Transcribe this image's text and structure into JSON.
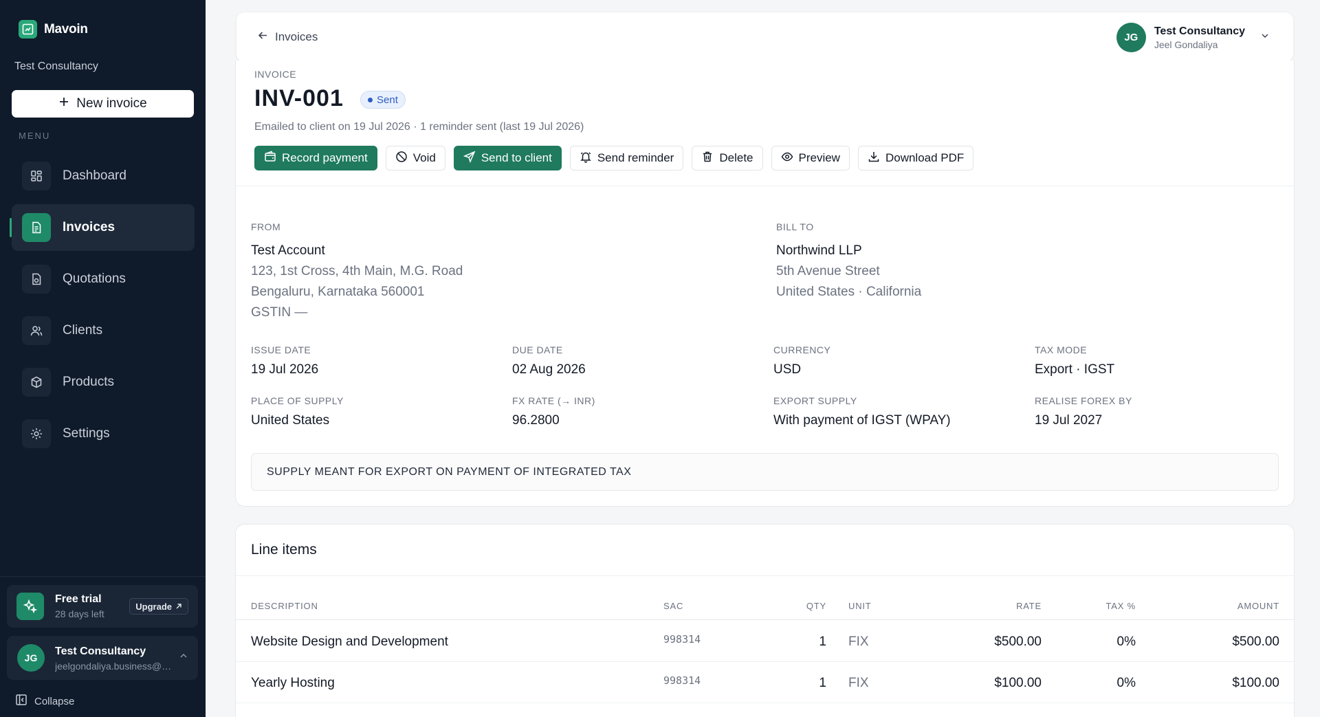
{
  "sidebar": {
    "brand": "Mavoin",
    "org": "Test Consultancy",
    "new_invoice": "New invoice",
    "menu_label": "MENU",
    "items": [
      {
        "label": "Dashboard",
        "icon": "dashboard-icon"
      },
      {
        "label": "Invoices",
        "icon": "invoice-icon",
        "active": true
      },
      {
        "label": "Quotations",
        "icon": "quotation-icon"
      },
      {
        "label": "Clients",
        "icon": "clients-icon"
      },
      {
        "label": "Products",
        "icon": "products-icon"
      },
      {
        "label": "Settings",
        "icon": "settings-icon"
      }
    ],
    "trial": {
      "title": "Free trial",
      "sub": "28 days left",
      "upgrade": "Upgrade"
    },
    "account": {
      "initials": "JG",
      "name": "Test Consultancy",
      "email": "jeelgondaliya.business@gmail.com"
    },
    "collapse": "Collapse"
  },
  "header": {
    "back": "Invoices",
    "user": {
      "initials": "JG",
      "name": "Test Consultancy",
      "sub": "Jeel Gondaliya"
    }
  },
  "invoice": {
    "label": "INVOICE",
    "number": "INV-001",
    "status": "Sent",
    "meta": "Emailed to client on 19 Jul 2026 · 1 reminder sent (last 19 Jul 2026)",
    "actions": {
      "record_payment": "Record payment",
      "void": "Void",
      "send_to_client": "Send to client",
      "send_reminder": "Send reminder",
      "delete": "Delete",
      "preview": "Preview",
      "download_pdf": "Download PDF"
    },
    "from": {
      "label": "FROM",
      "name": "Test Account",
      "line1": "123, 1st Cross, 4th Main, M.G. Road",
      "line2": "Bengaluru, Karnataka 560001",
      "line3": "GSTIN —"
    },
    "bill_to": {
      "label": "BILL TO",
      "name": "Northwind LLP",
      "line1": "5th Avenue Street",
      "line2": "United States · California"
    },
    "fields": {
      "issue_date": {
        "label": "ISSUE DATE",
        "value": "19 Jul 2026"
      },
      "due_date": {
        "label": "DUE DATE",
        "value": "02 Aug 2026"
      },
      "currency": {
        "label": "CURRENCY",
        "value": "USD"
      },
      "tax_mode": {
        "label": "TAX MODE",
        "value": "Export · IGST"
      },
      "place_of_supply": {
        "label": "PLACE OF SUPPLY",
        "value": "United States"
      },
      "fx_rate": {
        "label": "FX RATE (→ INR)",
        "value": "96.2800"
      },
      "export_supply": {
        "label": "EXPORT SUPPLY",
        "value": "With payment of IGST (WPAY)"
      },
      "realise_forex": {
        "label": "REALISE FOREX BY",
        "value": "19 Jul 2027"
      }
    },
    "notice": "SUPPLY MEANT FOR EXPORT ON PAYMENT OF INTEGRATED TAX"
  },
  "line_items": {
    "title": "Line items",
    "columns": {
      "description": "DESCRIPTION",
      "sac": "SAC",
      "qty": "QTY",
      "unit": "UNIT",
      "rate": "RATE",
      "tax": "TAX %",
      "amount": "AMOUNT"
    },
    "rows": [
      {
        "description": "Website Design and Development",
        "sac": "998314",
        "qty": "1",
        "unit": "FIX",
        "rate": "$500.00",
        "tax": "0%",
        "amount": "$500.00"
      },
      {
        "description": "Yearly Hosting",
        "sac": "998314",
        "qty": "1",
        "unit": "FIX",
        "rate": "$100.00",
        "tax": "0%",
        "amount": "$100.00"
      }
    ]
  },
  "colors": {
    "sidebar_bg": "#0f1a2a",
    "accent": "#1f7a5e",
    "status_blue": "#2f5cc4"
  }
}
